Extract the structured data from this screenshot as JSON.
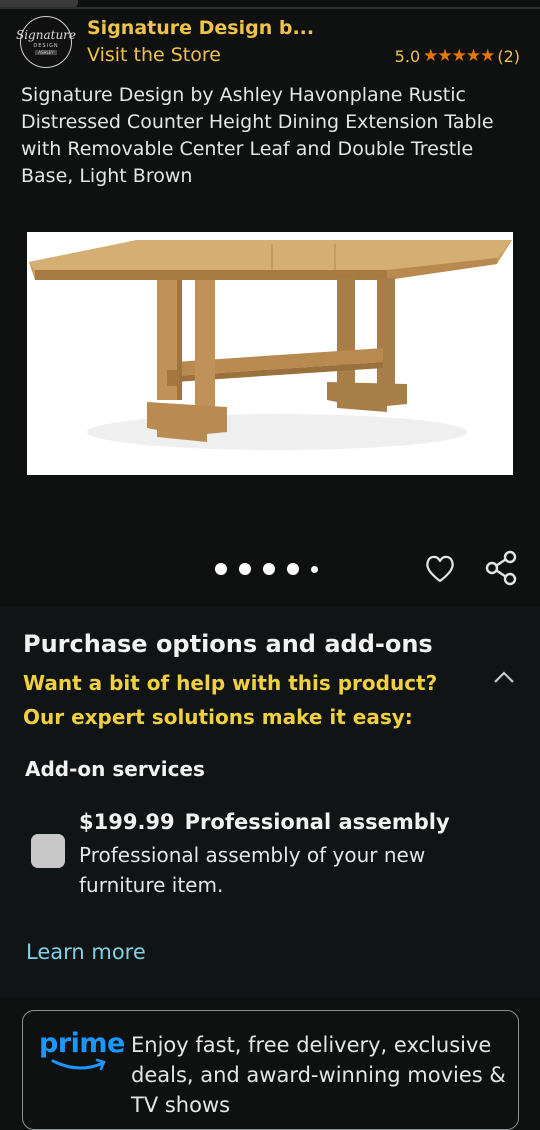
{
  "brand": {
    "logo_line1": "Signature",
    "logo_line2": "DESIGN",
    "logo_line3": "ASHLEY",
    "name": "Signature Design b...",
    "visit_store": "Visit the Store",
    "rating_value": "5.0",
    "stars": "★★★★★",
    "rating_count": "(2)"
  },
  "product": {
    "title": "Signature Design by Ashley Havonplane Rustic Distressed Counter Height Dining Extension Table with Removable Center Leaf and Double Trestle Base, Light Brown",
    "image_count": 5,
    "active_image_index": 0
  },
  "purchase": {
    "title": "Purchase options and add-ons",
    "help_line1": "Want a bit of help with this product?",
    "help_line2": "Our expert solutions make it easy:",
    "addon_title": "Add-on services",
    "addon": {
      "price": "$199.99",
      "name": "Professional assembly",
      "description": "Professional assembly of your new furniture item.",
      "checked": false
    },
    "learn_more": "Learn more"
  },
  "prime": {
    "logo_text": "prime",
    "text": "Enjoy fast, free delivery, exclusive deals, and award-winning movies & TV shows"
  },
  "colors": {
    "background": "#0f1111",
    "accent_yellow": "#f0c14b",
    "star_orange": "#e77600",
    "link_cyan": "#7fd1e8",
    "prime_blue": "#1a98ff"
  }
}
